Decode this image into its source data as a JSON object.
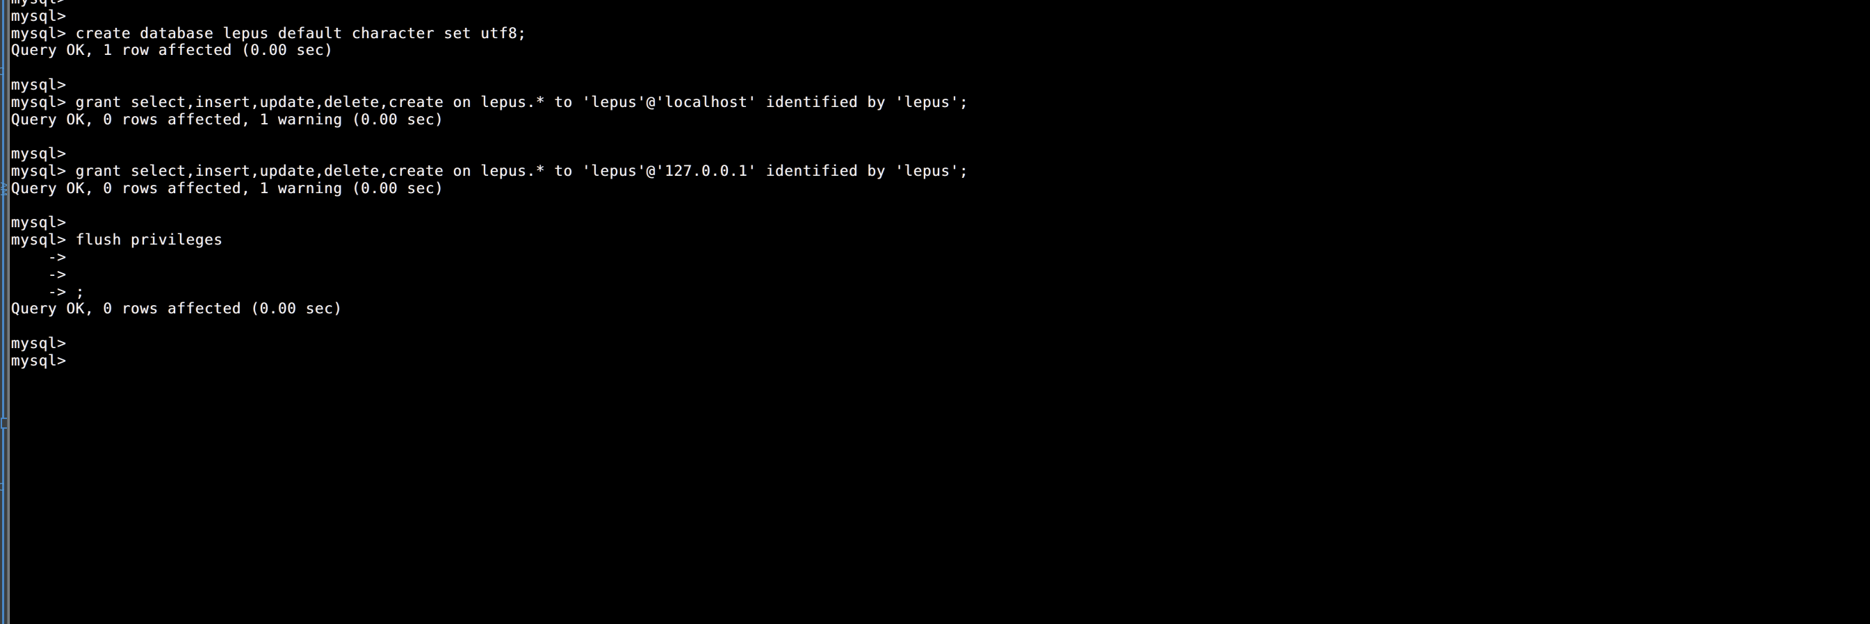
{
  "window": {
    "background_color": "#000000",
    "text_color": "#f2f2f2",
    "accent_color": "#4a88c7",
    "gutter_color": "#3b3f41"
  },
  "gutter": {
    "glyph_1": "C",
    "glyph_2": "AM",
    "glyph_3": "C"
  },
  "terminal": {
    "prompt": "mysql>",
    "continuation_prompt": "->",
    "lines": [
      {
        "id": "line-00",
        "text": "mysql>",
        "kind": "prompt"
      },
      {
        "id": "line-01",
        "text": "mysql>",
        "kind": "prompt"
      },
      {
        "id": "line-02",
        "text": "mysql> create database lepus default character set utf8;",
        "kind": "command"
      },
      {
        "id": "line-03",
        "text": "Query OK, 1 row affected (0.00 sec)",
        "kind": "result"
      },
      {
        "id": "line-04",
        "text": "",
        "kind": "blank"
      },
      {
        "id": "line-05",
        "text": "mysql>",
        "kind": "prompt"
      },
      {
        "id": "line-06",
        "text": "mysql> grant select,insert,update,delete,create on lepus.* to 'lepus'@'localhost' identified by 'lepus';",
        "kind": "command"
      },
      {
        "id": "line-07",
        "text": "Query OK, 0 rows affected, 1 warning (0.00 sec)",
        "kind": "result"
      },
      {
        "id": "line-08",
        "text": "",
        "kind": "blank"
      },
      {
        "id": "line-09",
        "text": "mysql>",
        "kind": "prompt"
      },
      {
        "id": "line-10",
        "text": "mysql> grant select,insert,update,delete,create on lepus.* to 'lepus'@'127.0.0.1' identified by 'lepus';",
        "kind": "command"
      },
      {
        "id": "line-11",
        "text": "Query OK, 0 rows affected, 1 warning (0.00 sec)",
        "kind": "result"
      },
      {
        "id": "line-12",
        "text": "",
        "kind": "blank"
      },
      {
        "id": "line-13",
        "text": "mysql>",
        "kind": "prompt"
      },
      {
        "id": "line-14",
        "text": "mysql> flush privileges",
        "kind": "command"
      },
      {
        "id": "line-15",
        "text": "    ->",
        "kind": "continuation"
      },
      {
        "id": "line-16",
        "text": "    ->",
        "kind": "continuation"
      },
      {
        "id": "line-17",
        "text": "    -> ;",
        "kind": "continuation"
      },
      {
        "id": "line-18",
        "text": "Query OK, 0 rows affected (0.00 sec)",
        "kind": "result"
      },
      {
        "id": "line-19",
        "text": "",
        "kind": "blank"
      },
      {
        "id": "line-20",
        "text": "mysql>",
        "kind": "prompt"
      },
      {
        "id": "line-21",
        "text": "mysql>",
        "kind": "prompt"
      }
    ]
  }
}
